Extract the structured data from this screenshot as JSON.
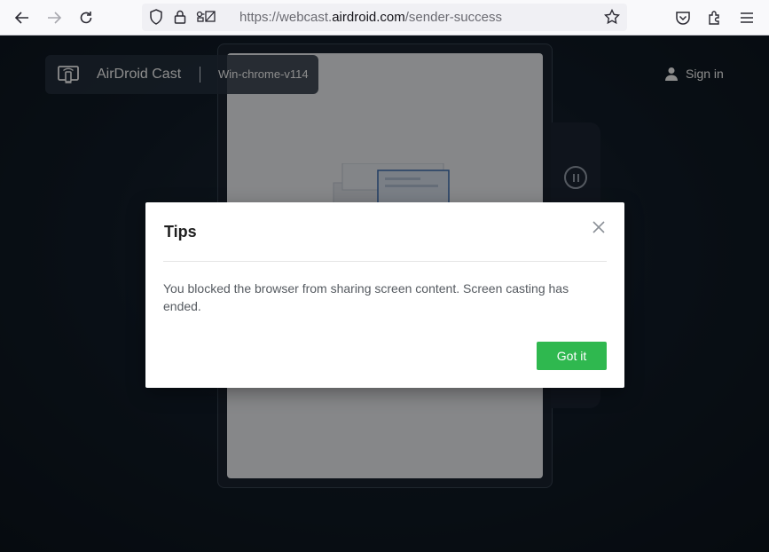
{
  "browser": {
    "url_prefix": "https://webcast.",
    "url_domain": "airdroid.com",
    "url_path": "/sender-success"
  },
  "header": {
    "brand_name": "AirDroid Cast",
    "device_name": "Win-chrome-v114",
    "signin_label": "Sign in"
  },
  "dialog": {
    "title": "Tips",
    "message": "You blocked the browser from sharing screen content. Screen casting has ended.",
    "confirm_label": "Got it"
  },
  "colors": {
    "accent_green": "#2fb84f",
    "page_bg": "#0d1620"
  }
}
